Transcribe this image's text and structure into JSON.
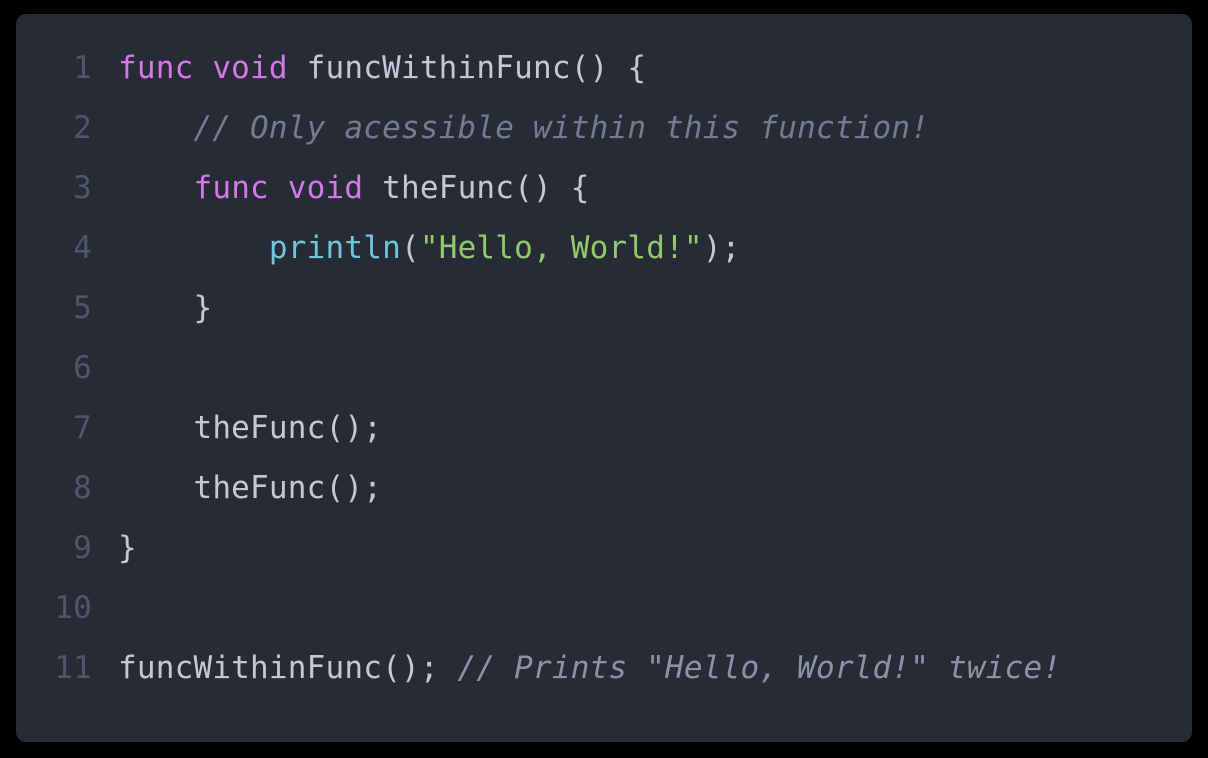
{
  "editor": {
    "language": "swift-like",
    "theme": {
      "outer_background": "#000000",
      "panel_background": "#262b36",
      "line_number_color": "#4f5767",
      "default_text_color": "#c3c9d4",
      "keyword_color": "#d377ea",
      "function_color": "#6ec6d6",
      "string_color": "#92c96a",
      "comment_color": "#8b93a3"
    },
    "line_numbers": [
      "1",
      "2",
      "3",
      "4",
      "5",
      "6",
      "7",
      "8",
      "9",
      "10",
      "11"
    ],
    "lines": [
      {
        "number": "1",
        "text": "func void funcWithinFunc() {",
        "tokens": [
          {
            "t": "func void ",
            "c": "tok-keyword"
          },
          {
            "t": "funcWithinFunc() {",
            "c": "tok-plain"
          }
        ]
      },
      {
        "number": "2",
        "text": "    // Only acessible within this function!",
        "tokens": [
          {
            "t": "    ",
            "c": "tok-plain"
          },
          {
            "t": "// Only acessible within this function!",
            "c": "tok-comment-dim"
          }
        ]
      },
      {
        "number": "3",
        "text": "    func void theFunc() {",
        "tokens": [
          {
            "t": "    ",
            "c": "tok-plain"
          },
          {
            "t": "func void ",
            "c": "tok-keyword"
          },
          {
            "t": "theFunc() {",
            "c": "tok-plain"
          }
        ]
      },
      {
        "number": "4",
        "text": "        println(\"Hello, World!\");",
        "tokens": [
          {
            "t": "        ",
            "c": "tok-plain"
          },
          {
            "t": "println",
            "c": "tok-func"
          },
          {
            "t": "(",
            "c": "tok-punct"
          },
          {
            "t": "\"Hello, World!\"",
            "c": "tok-string"
          },
          {
            "t": ");",
            "c": "tok-punct"
          }
        ]
      },
      {
        "number": "5",
        "text": "    }",
        "tokens": [
          {
            "t": "    }",
            "c": "tok-plain"
          }
        ]
      },
      {
        "number": "6",
        "text": "",
        "tokens": []
      },
      {
        "number": "7",
        "text": "    theFunc();",
        "tokens": [
          {
            "t": "    theFunc();",
            "c": "tok-plain"
          }
        ]
      },
      {
        "number": "8",
        "text": "    theFunc();",
        "tokens": [
          {
            "t": "    theFunc();",
            "c": "tok-plain"
          }
        ]
      },
      {
        "number": "9",
        "text": "}",
        "tokens": [
          {
            "t": "}",
            "c": "tok-plain"
          }
        ]
      },
      {
        "number": "10",
        "text": "",
        "tokens": []
      },
      {
        "number": "11",
        "text": "funcWithinFunc(); // Prints \"Hello, World!\" twice!",
        "tokens": [
          {
            "t": "funcWithinFunc(); ",
            "c": "tok-plain"
          },
          {
            "t": "// Prints \"Hello, World!\" twice!",
            "c": "tok-comment"
          }
        ]
      }
    ]
  }
}
